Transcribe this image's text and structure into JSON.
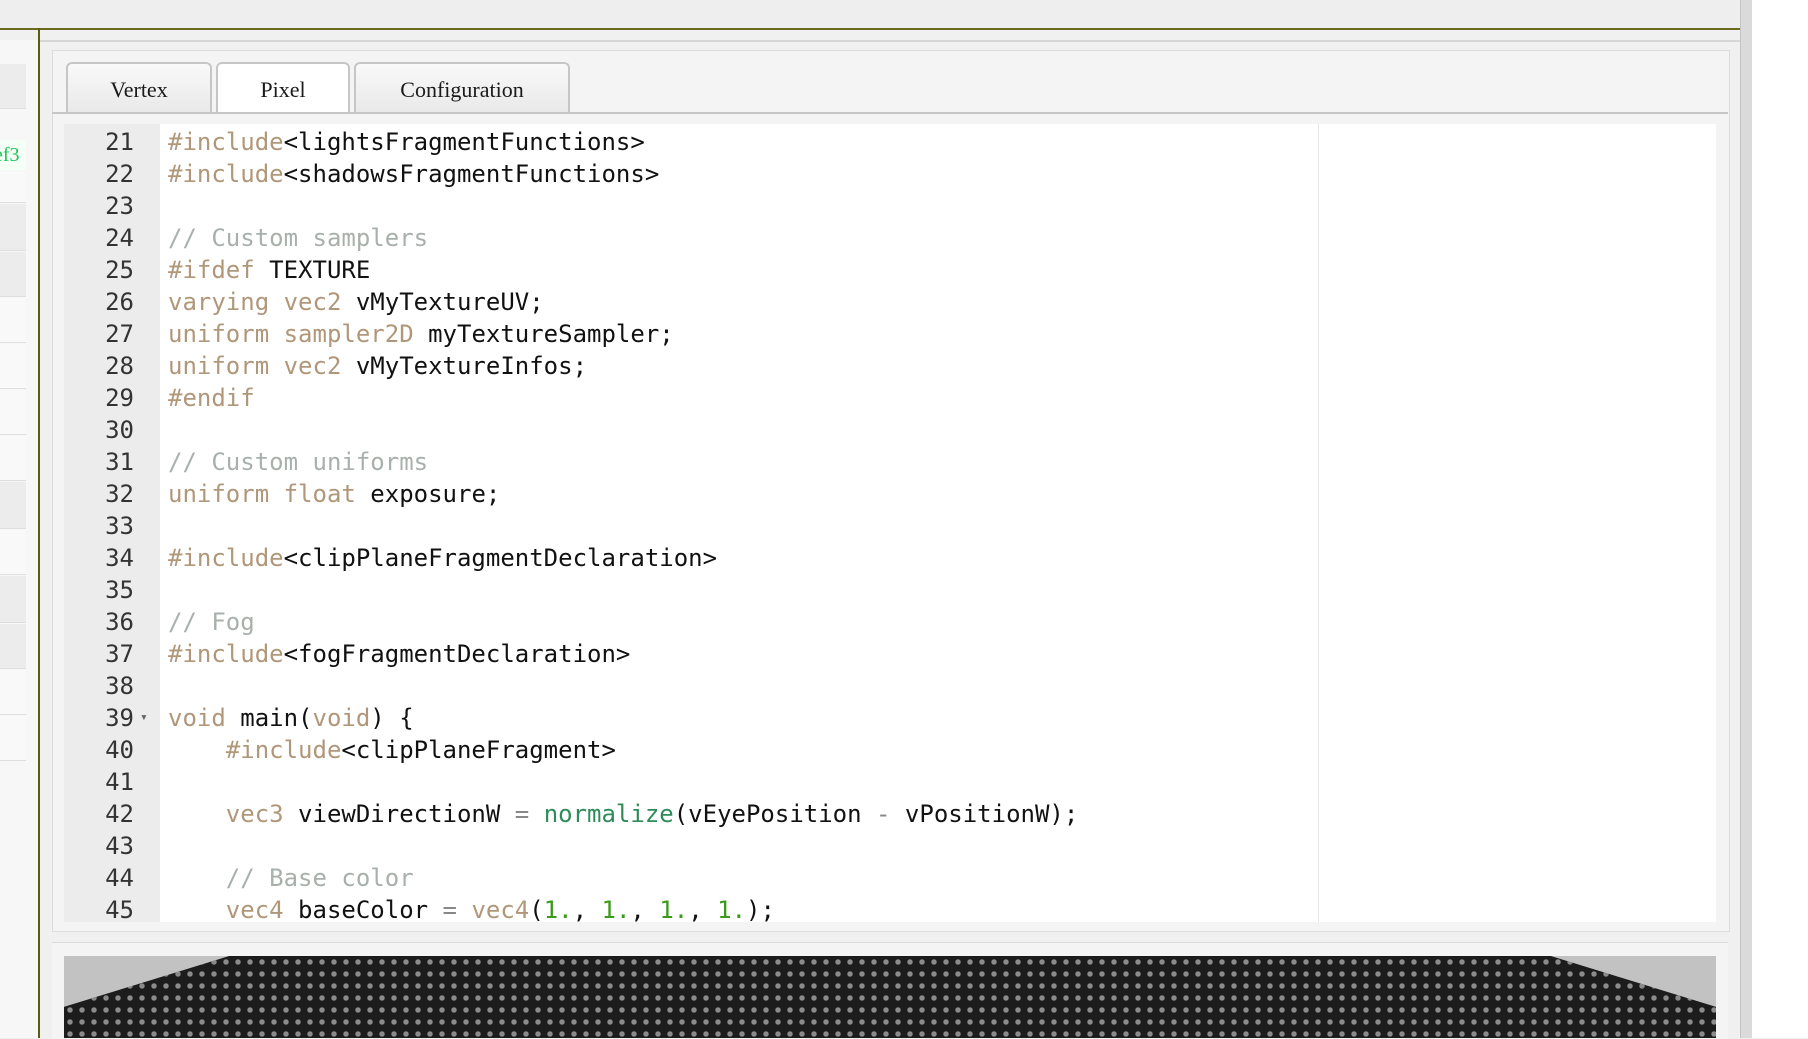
{
  "left_panel": {
    "selected_fragment": "ef3"
  },
  "tabs": [
    {
      "label": "Vertex",
      "active": false
    },
    {
      "label": "Pixel",
      "active": true
    },
    {
      "label": "Configuration",
      "active": false
    }
  ],
  "colors": {
    "keyword": "#b0977a",
    "comment": "#a8b0ab",
    "function": "#2f8c5a",
    "number": "#3c9a1a",
    "left_highlight": "#1fc45a",
    "separator": "#5c5c10"
  },
  "icons": {
    "fold": "fold-arrow-icon"
  },
  "editor": {
    "lines": [
      {
        "n": "21",
        "segs": [
          {
            "t": "#include",
            "c": "kw"
          },
          {
            "t": "<lightsFragmentFunctions>",
            "c": ""
          }
        ]
      },
      {
        "n": "22",
        "segs": [
          {
            "t": "#include",
            "c": "kw"
          },
          {
            "t": "<shadowsFragmentFunctions>",
            "c": ""
          }
        ]
      },
      {
        "n": "23",
        "segs": []
      },
      {
        "n": "24",
        "segs": [
          {
            "t": "// Custom samplers",
            "c": "cm"
          }
        ]
      },
      {
        "n": "25",
        "segs": [
          {
            "t": "#ifdef",
            "c": "kw"
          },
          {
            "t": " TEXTURE",
            "c": ""
          }
        ]
      },
      {
        "n": "26",
        "segs": [
          {
            "t": "varying vec2",
            "c": "kw"
          },
          {
            "t": " vMyTextureUV;",
            "c": ""
          }
        ]
      },
      {
        "n": "27",
        "segs": [
          {
            "t": "uniform sampler2D",
            "c": "kw"
          },
          {
            "t": " myTextureSampler;",
            "c": ""
          }
        ]
      },
      {
        "n": "28",
        "segs": [
          {
            "t": "uniform vec2",
            "c": "kw"
          },
          {
            "t": " vMyTextureInfos;",
            "c": ""
          }
        ]
      },
      {
        "n": "29",
        "segs": [
          {
            "t": "#endif",
            "c": "kw"
          }
        ]
      },
      {
        "n": "30",
        "segs": []
      },
      {
        "n": "31",
        "segs": [
          {
            "t": "// Custom uniforms",
            "c": "cm"
          }
        ]
      },
      {
        "n": "32",
        "segs": [
          {
            "t": "uniform float",
            "c": "kw"
          },
          {
            "t": " exposure;",
            "c": ""
          }
        ]
      },
      {
        "n": "33",
        "segs": []
      },
      {
        "n": "34",
        "segs": [
          {
            "t": "#include",
            "c": "kw"
          },
          {
            "t": "<clipPlaneFragmentDeclaration>",
            "c": ""
          }
        ]
      },
      {
        "n": "35",
        "segs": []
      },
      {
        "n": "36",
        "segs": [
          {
            "t": "// Fog",
            "c": "cm"
          }
        ]
      },
      {
        "n": "37",
        "segs": [
          {
            "t": "#include",
            "c": "kw"
          },
          {
            "t": "<fogFragmentDeclaration>",
            "c": ""
          }
        ]
      },
      {
        "n": "38",
        "segs": []
      },
      {
        "n": "39",
        "fold": true,
        "segs": [
          {
            "t": "void",
            "c": "kw"
          },
          {
            "t": " main(",
            "c": ""
          },
          {
            "t": "void",
            "c": "kw"
          },
          {
            "t": ") {",
            "c": ""
          }
        ]
      },
      {
        "n": "40",
        "segs": [
          {
            "t": "    ",
            "c": ""
          },
          {
            "t": "#include",
            "c": "kw"
          },
          {
            "t": "<clipPlaneFragment>",
            "c": ""
          }
        ]
      },
      {
        "n": "41",
        "segs": []
      },
      {
        "n": "42",
        "segs": [
          {
            "t": "    ",
            "c": ""
          },
          {
            "t": "vec3",
            "c": "kw"
          },
          {
            "t": " viewDirectionW ",
            "c": ""
          },
          {
            "t": "=",
            "c": "op"
          },
          {
            "t": " ",
            "c": ""
          },
          {
            "t": "normalize",
            "c": "fn"
          },
          {
            "t": "(vEyePosition ",
            "c": ""
          },
          {
            "t": "-",
            "c": "op"
          },
          {
            "t": " vPositionW);",
            "c": ""
          }
        ]
      },
      {
        "n": "43",
        "segs": []
      },
      {
        "n": "44",
        "segs": [
          {
            "t": "    ",
            "c": ""
          },
          {
            "t": "// Base color",
            "c": "cm"
          }
        ]
      },
      {
        "n": "45",
        "segs": [
          {
            "t": "    ",
            "c": ""
          },
          {
            "t": "vec4",
            "c": "kw"
          },
          {
            "t": " baseColor ",
            "c": ""
          },
          {
            "t": "=",
            "c": "op"
          },
          {
            "t": " ",
            "c": ""
          },
          {
            "t": "vec4",
            "c": "kw"
          },
          {
            "t": "(",
            "c": ""
          },
          {
            "t": "1.",
            "c": "nm"
          },
          {
            "t": ", ",
            "c": ""
          },
          {
            "t": "1.",
            "c": "nm"
          },
          {
            "t": ", ",
            "c": ""
          },
          {
            "t": "1.",
            "c": "nm"
          },
          {
            "t": ", ",
            "c": ""
          },
          {
            "t": "1.",
            "c": "nm"
          },
          {
            "t": ");",
            "c": ""
          }
        ]
      }
    ]
  }
}
